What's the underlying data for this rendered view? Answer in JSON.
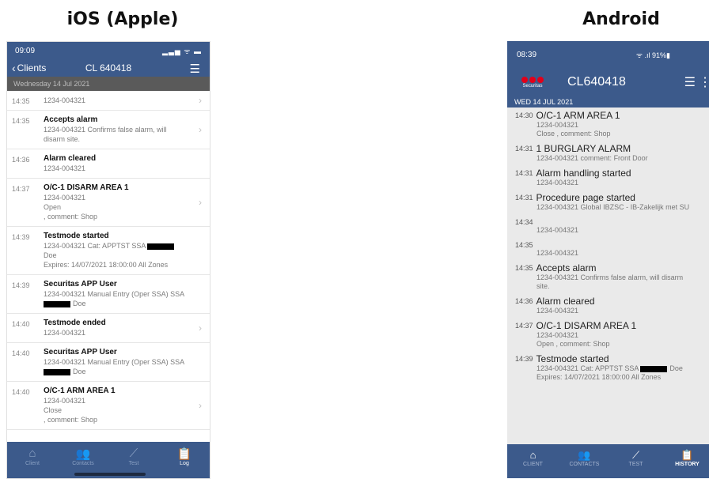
{
  "captions": {
    "ios": "iOS (Apple)",
    "android": "Android"
  },
  "ios": {
    "status_time": "09:09",
    "status_right": "▂▃▅ ᯤ ▬",
    "back_label": "Clients",
    "title": "CL 640418",
    "date": "Wednesday 14 Jul 2021",
    "rows": [
      {
        "time": "14:35",
        "head": "",
        "lines": [
          "1234-004321"
        ],
        "chevron": true
      },
      {
        "time": "14:35",
        "head": "Accepts alarm",
        "lines": [
          "1234-004321 Confirms false alarm, will",
          "disarm site."
        ],
        "chevron": true
      },
      {
        "time": "14:36",
        "head": "Alarm cleared",
        "lines": [
          "1234-004321"
        ],
        "chevron": false
      },
      {
        "time": "14:37",
        "head": "O/C-1 DISARM AREA 1",
        "lines": [
          "1234-004321",
          "Open",
          ", comment: Shop"
        ],
        "chevron": true
      },
      {
        "time": "14:39",
        "head": "Testmode started",
        "lines": [
          "1234-004321 Cat: APPTST SSA ▮Doe",
          "Expires: 14/07/2021 18:00:00  All Zones"
        ],
        "chevron": false
      },
      {
        "time": "14:39",
        "head": "Securitas APP User",
        "lines": [
          "1234-004321 Manual Entry (Oper SSA) SSA",
          "▮Doe"
        ],
        "chevron": false
      },
      {
        "time": "14:40",
        "head": "Testmode ended",
        "lines": [
          "1234-004321"
        ],
        "chevron": true
      },
      {
        "time": "14:40",
        "head": "Securitas APP User",
        "lines": [
          "1234-004321 Manual Entry (Oper SSA) SSA",
          "▮Doe"
        ],
        "chevron": false
      },
      {
        "time": "14:40",
        "head": "O/C-1 ARM AREA 1",
        "lines": [
          "1234-004321",
          "Close",
          ", comment: Shop"
        ],
        "chevron": true
      }
    ],
    "tabs": [
      {
        "label": "Client",
        "icon": "⌂"
      },
      {
        "label": "Contacts",
        "icon": "👥"
      },
      {
        "label": "Test",
        "icon": "⟋"
      },
      {
        "label": "Log",
        "icon": "📋"
      }
    ]
  },
  "android": {
    "status_time": "08:39",
    "status_right": "ᯤ .ıl 91%▮",
    "logo_text": "Securitas",
    "title": "CL640418",
    "date": "WED 14 JUL 2021",
    "rows": [
      {
        "time": "14:30",
        "head": "O/C-1 ARM AREA 1",
        "lines": [
          "1234-004321",
          "Close , comment: Shop"
        ],
        "chevron": true
      },
      {
        "time": "14:31",
        "head": "1 BURGLARY ALARM",
        "lines": [
          "1234-004321 comment: Front Door"
        ],
        "chevron": true
      },
      {
        "time": "14:31",
        "head": "Alarm handling started",
        "lines": [
          "1234-004321"
        ],
        "chevron": false
      },
      {
        "time": "14:31",
        "head": "Procedure page started",
        "lines": [
          "1234-004321 Global IBZSC - IB-Zakelijk met SU"
        ],
        "chevron": false
      },
      {
        "time": "14:34",
        "head": "",
        "lines": [
          "1234-004321"
        ],
        "chevron": true
      },
      {
        "time": "14:35",
        "head": "",
        "lines": [
          "1234-004321"
        ],
        "chevron": true
      },
      {
        "time": "14:35",
        "head": "Accepts alarm",
        "lines": [
          "1234-004321 Confirms false alarm, will disarm",
          "site."
        ],
        "chevron": true
      },
      {
        "time": "14:36",
        "head": "Alarm cleared",
        "lines": [
          "1234-004321"
        ],
        "chevron": false
      },
      {
        "time": "14:37",
        "head": "O/C-1 DISARM AREA 1",
        "lines": [
          "1234-004321",
          "Open , comment: Shop"
        ],
        "chevron": true
      },
      {
        "time": "14:39",
        "head": "Testmode started",
        "lines": [
          "1234-004321 Cat: APPTST SSA ▮Doe",
          "Expires: 14/07/2021 18:00:00 All Zones"
        ],
        "chevron": false
      }
    ],
    "tabs": [
      {
        "label": "CLIENT",
        "icon": "⌂"
      },
      {
        "label": "CONTACTS",
        "icon": "👥"
      },
      {
        "label": "TEST",
        "icon": "⟋"
      },
      {
        "label": "HISTORY",
        "icon": "📋"
      }
    ],
    "sysnav": [
      "|||",
      "○",
      "‹"
    ]
  }
}
